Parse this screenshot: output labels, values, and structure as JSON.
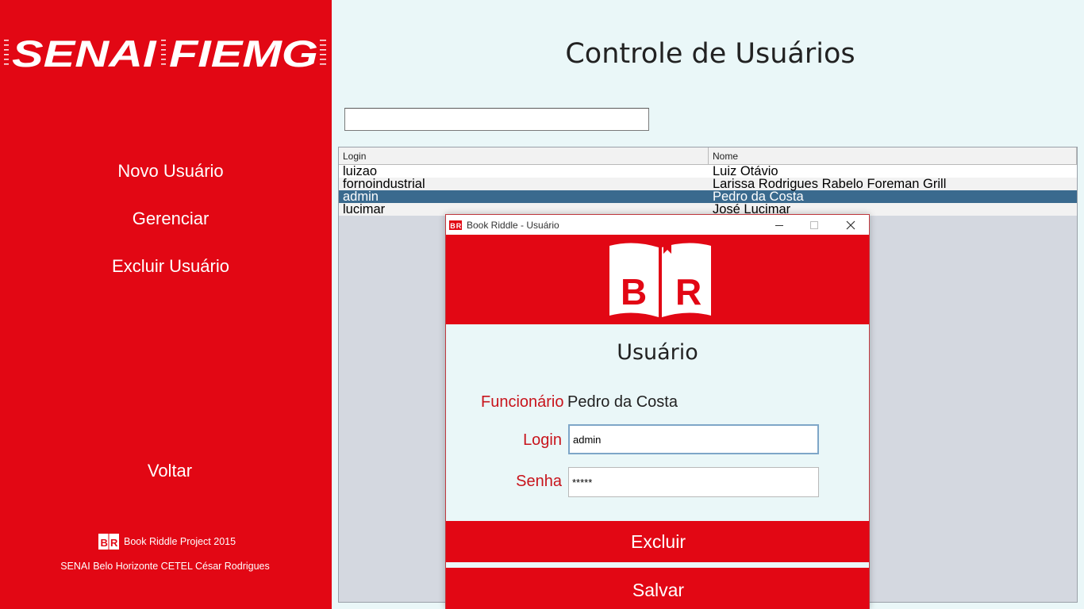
{
  "sidebar": {
    "logo_text": "SENAI FIEMG",
    "nav": {
      "new_user": "Novo Usuário",
      "manage": "Gerenciar",
      "delete_user": "Excluir Usuário",
      "back": "Voltar"
    },
    "footer_brand": "Book Riddle Project 2015",
    "footer_credit": "SENAI Belo Horizonte CETEL César Rodrigues"
  },
  "main": {
    "title": "Controle de Usuários",
    "search": {
      "value": "",
      "placeholder": ""
    },
    "table": {
      "columns": [
        "Login",
        "Nome"
      ],
      "rows": [
        {
          "login": "luizao",
          "nome": "Luiz Otávio"
        },
        {
          "login": "fornoindustrial",
          "nome": "Larissa Rodrigues Rabelo Foreman Grill"
        },
        {
          "login": "admin",
          "nome": "Pedro da Costa"
        },
        {
          "login": "lucimar",
          "nome": "José Lucimar"
        }
      ],
      "selected_login": "admin"
    }
  },
  "dialog": {
    "window_title": "Book Riddle - Usuário",
    "banner_logo": {
      "letters": [
        "B",
        "R"
      ]
    },
    "heading": "Usuário",
    "employee_label": "Funcionário",
    "employee_value": "Pedro da Costa",
    "login_label": "Login",
    "login_value": "admin",
    "password_label": "Senha",
    "password_value": "*****",
    "delete_button": "Excluir",
    "save_button": "Salvar"
  },
  "colors": {
    "brand_red": "#e20714",
    "background": "#eaf7f8",
    "selection_blue": "#3a6a8e",
    "label_red": "#c8141c"
  },
  "icons": [
    "senai-fiemg-logo",
    "book-riddle-logo-icon",
    "minimize-icon",
    "maximize-icon",
    "close-icon"
  ]
}
